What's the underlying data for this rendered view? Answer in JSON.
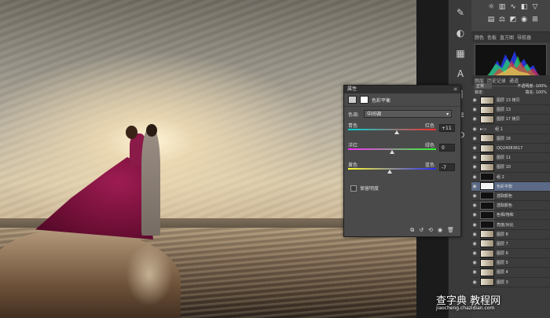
{
  "properties_panel": {
    "title": "属性",
    "adjustment_name": "色彩平衡",
    "tone": {
      "label": "色调:",
      "value": "中间调"
    },
    "sliders": [
      {
        "left": "青色",
        "right": "红色",
        "value": "+11",
        "fraction": 0.55,
        "gradient": [
          "#00d6d6",
          "#ff2a2a"
        ]
      },
      {
        "left": "洋红",
        "right": "绿色",
        "value": "0",
        "fraction": 0.5,
        "gradient": [
          "#ff2aff",
          "#2aff2a"
        ]
      },
      {
        "left": "黄色",
        "right": "蓝色",
        "value": "-7",
        "fraction": 0.47,
        "gradient": [
          "#ffff2a",
          "#2a2aff"
        ]
      }
    ],
    "preserve_luminosity": "保留明度"
  },
  "right_panel": {
    "tabs": [
      "颜色",
      "色板",
      "直方图",
      "导航器"
    ],
    "layer_tabs": [
      "图层",
      "历史记录",
      "通道"
    ],
    "blend_mode": "正常",
    "opacity_label": "不透明度:",
    "opacity_value": "100%",
    "lock_label": "锁定:",
    "fill_label": "填充:",
    "fill_value": "100%",
    "layers": [
      {
        "name": "图层 13 拷贝",
        "thumb": "photo"
      },
      {
        "name": "图层 13",
        "thumb": "photo"
      },
      {
        "name": "图层 17 拷贝",
        "thumb": "photo"
      },
      {
        "name": "组 1",
        "thumb": "none"
      },
      {
        "name": "图层 16",
        "thumb": "photo"
      },
      {
        "name": "QQ24083617",
        "thumb": "photo"
      },
      {
        "name": "图层 11",
        "thumb": "photo"
      },
      {
        "name": "图层 10",
        "thumb": "photo"
      },
      {
        "name": "组 2",
        "thumb": "dark"
      },
      {
        "name": "色彩平衡",
        "thumb": "white",
        "selected": true
      },
      {
        "name": "选取颜色",
        "thumb": "dark"
      },
      {
        "name": "选取颜色",
        "thumb": "dark"
      },
      {
        "name": "色相/饱和",
        "thumb": "dark"
      },
      {
        "name": "亮度/对比",
        "thumb": "dark"
      },
      {
        "name": "图层 8",
        "thumb": "photo"
      },
      {
        "name": "图层 7",
        "thumb": "photo"
      },
      {
        "name": "图层 6",
        "thumb": "photo"
      },
      {
        "name": "图层 5",
        "thumb": "photo"
      },
      {
        "name": "图层 4",
        "thumb": "photo"
      },
      {
        "name": "图层 3",
        "thumb": "photo"
      }
    ]
  },
  "watermark": {
    "main": "查字典 教程网",
    "sub": "jiaocheng.chazidian.com"
  }
}
